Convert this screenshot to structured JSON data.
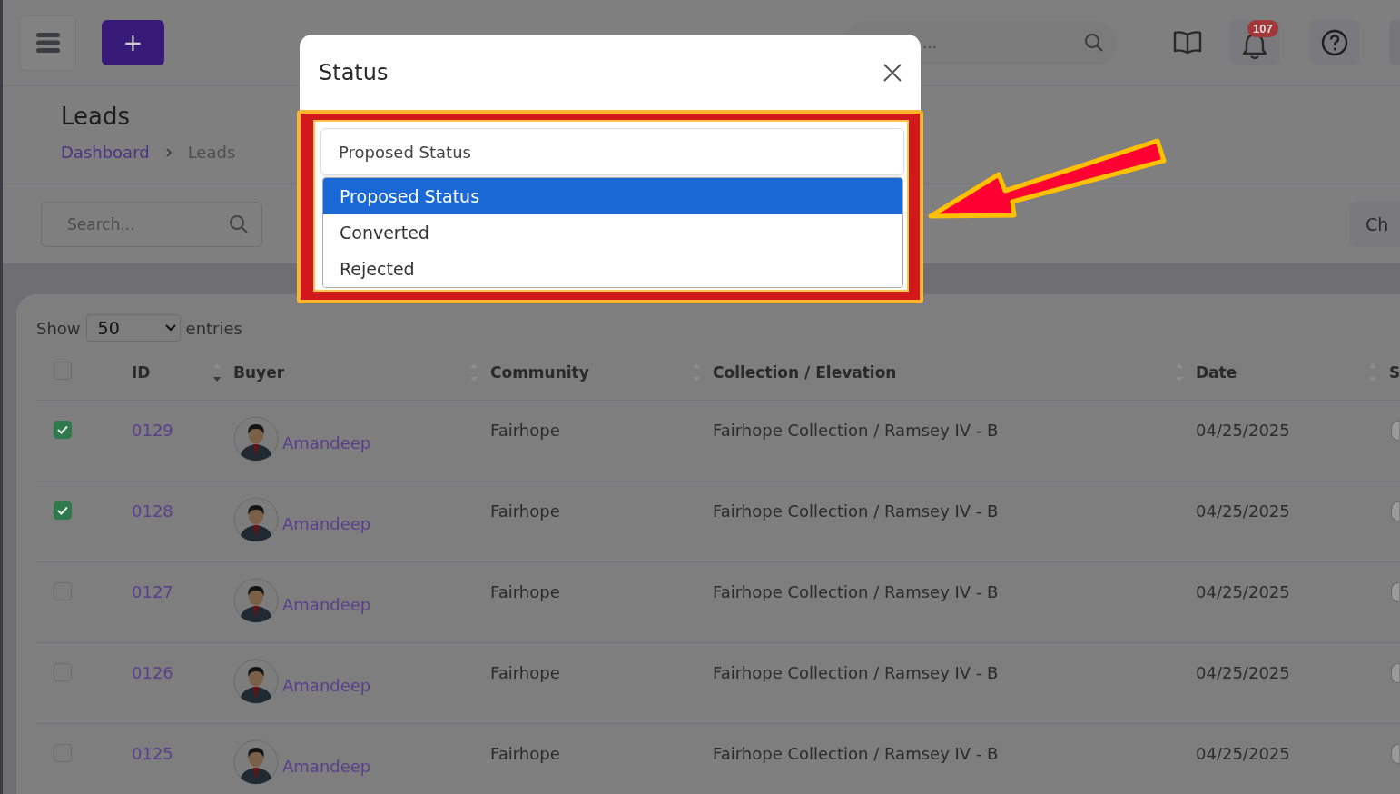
{
  "header": {
    "add_button": "+",
    "search": {
      "placeholder": "…"
    },
    "notifications": {
      "badge": "107"
    }
  },
  "page": {
    "title": "Leads",
    "breadcrumb": [
      {
        "label": "Dashboard",
        "link": true
      },
      {
        "label": "Leads",
        "link": false
      }
    ],
    "search": {
      "placeholder": "Search..."
    },
    "right_button": "Ch"
  },
  "table": {
    "show_label": "Show",
    "page_size": "50",
    "entries_label": "entries",
    "select_all_checked": false,
    "columns": [
      {
        "label": "ID",
        "sorted": true
      },
      {
        "label": "Buyer",
        "sorted": false
      },
      {
        "label": "Community",
        "sorted": false
      },
      {
        "label": "Collection / Elevation",
        "sorted": false
      },
      {
        "label": "Date",
        "sorted": false
      },
      {
        "label": "S"
      }
    ],
    "rows": [
      {
        "checked": true,
        "id": "0129",
        "buyer": "Amandeep",
        "community": "Fairhope",
        "collection": "Fairhope Collection / Ramsey IV - B",
        "date": "04/25/2025"
      },
      {
        "checked": true,
        "id": "0128",
        "buyer": "Amandeep",
        "community": "Fairhope",
        "collection": "Fairhope Collection / Ramsey IV - B",
        "date": "04/25/2025"
      },
      {
        "checked": false,
        "id": "0127",
        "buyer": "Amandeep",
        "community": "Fairhope",
        "collection": "Fairhope Collection / Ramsey IV - B",
        "date": "04/25/2025"
      },
      {
        "checked": false,
        "id": "0126",
        "buyer": "Amandeep",
        "community": "Fairhope",
        "collection": "Fairhope Collection / Ramsey IV - B",
        "date": "04/25/2025"
      },
      {
        "checked": false,
        "id": "0125",
        "buyer": "Amandeep",
        "community": "Fairhope",
        "collection": "Fairhope Collection / Ramsey IV - B",
        "date": "04/25/2025"
      }
    ]
  },
  "modal": {
    "title": "Status",
    "select_value": "Proposed Status",
    "options": [
      {
        "label": "Proposed Status",
        "selected": true
      },
      {
        "label": "Converted",
        "selected": false
      },
      {
        "label": "Rejected",
        "selected": false
      }
    ]
  }
}
